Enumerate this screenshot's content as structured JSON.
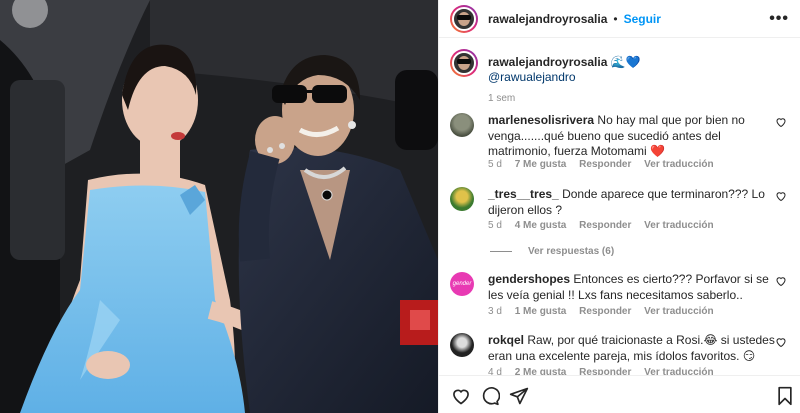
{
  "header": {
    "username": "rawalejandroyrosalia",
    "separator": "•",
    "follow_label": "Seguir",
    "more_label": "•••"
  },
  "caption": {
    "username": "rawalejandroyrosalia",
    "emojis": "🌊💙",
    "mention": "@rawualejandro",
    "time": "1 sem"
  },
  "comments": [
    {
      "username": "marlenesolisrivera",
      "text": "No hay mal que por bien no venga.......qué bueno que sucedió antes del matrimonio, fuerza Motomami ❤️",
      "time": "5 d",
      "likes": "7 Me gusta",
      "reply": "Responder",
      "translate": "Ver traducción"
    },
    {
      "username": "_tres__tres_",
      "text": "Donde aparece que terminaron??? Lo dijeron ellos ?",
      "time": "5 d",
      "likes": "4 Me gusta",
      "reply": "Responder",
      "translate": "Ver traducción",
      "view_replies": "Ver respuestas (6)"
    },
    {
      "username": "gendershopes",
      "text": "Entonces es cierto??? Porfavor si se les veía genial !! Lxs fans necesitamos saberlo..",
      "time": "3 d",
      "likes": "1 Me gusta",
      "reply": "Responder",
      "translate": "Ver traducción",
      "avatar_text": "gender"
    },
    {
      "username": "rokqel",
      "text": "Raw, por qué traicionaste a Rosi.😂 si ustedes eran una excelente pareja, mis ídolos favoritos. 😏",
      "time": "4 d",
      "likes": "2 Me gusta",
      "reply": "Responder",
      "translate": "Ver traducción"
    }
  ],
  "actions": [
    "heart-icon",
    "comment-icon",
    "share-icon",
    "bookmark-icon"
  ],
  "colors": {
    "link": "#0095f6",
    "muted": "#8e8e8e",
    "heart_emoji": "#e0245e"
  }
}
